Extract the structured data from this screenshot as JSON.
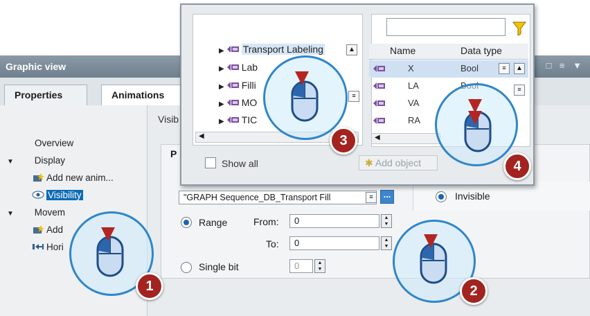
{
  "window": {
    "title": "Graphic view",
    "controls": "□ ≡ ▼"
  },
  "tabs": [
    {
      "label": "Properties"
    },
    {
      "label": "Animations"
    }
  ],
  "tree": {
    "overview": "Overview",
    "display": "Display",
    "add_new_anim": "Add new anim...",
    "visibility": "Visibility",
    "movement": "Movem",
    "add": "Add",
    "hori": "Hori"
  },
  "main": {
    "section_label": "Visib",
    "panel_title": "P",
    "tag_value": "\"GRAPH Sequence_DB_Transport Fill",
    "browse_label": "...",
    "range_label": "Range",
    "from_label": "From:",
    "from_value": "0",
    "to_label": "To:",
    "to_value": "0",
    "single_bit_label": "Single bit",
    "single_bit_value": "0",
    "invisible_label": "Invisible"
  },
  "popup": {
    "tree_items": [
      {
        "label": "Transport Labeling"
      },
      {
        "label": "Lab"
      },
      {
        "label": "Filli"
      },
      {
        "label": "MO"
      },
      {
        "label": "TIC"
      }
    ],
    "columns": {
      "name": "Name",
      "data_type": "Data type"
    },
    "rows": [
      {
        "name": "X",
        "type": "Bool"
      },
      {
        "name": "LA",
        "type": "Bool"
      },
      {
        "name": "VA",
        "type": ""
      },
      {
        "name": "RA",
        "type": ""
      }
    ],
    "show_all": "Show all",
    "add_object": "Add object"
  },
  "steps": [
    "1",
    "2",
    "3",
    "4"
  ],
  "colors": {
    "accent": "#2f86c8",
    "badge": "#a2231f",
    "selection": "#0c6bb5"
  }
}
